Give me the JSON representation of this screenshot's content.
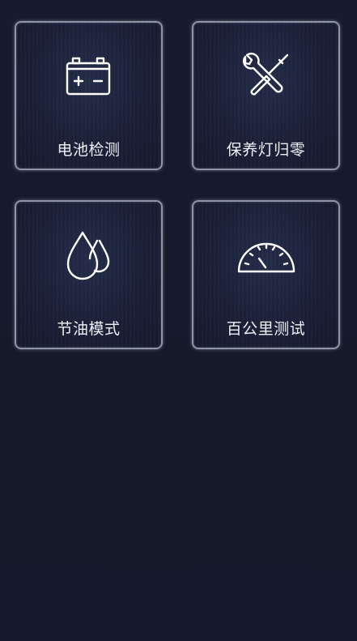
{
  "tiles": [
    {
      "label": "电池检测",
      "icon": "battery-icon"
    },
    {
      "label": "保养灯归零",
      "icon": "wrench-screwdriver-icon"
    },
    {
      "label": "节油模式",
      "icon": "water-drops-icon"
    },
    {
      "label": "百公里测试",
      "icon": "speedometer-icon"
    }
  ],
  "colors": {
    "background": "#161a2c",
    "tile_border": "#8e95a7",
    "text": "#eef1f6"
  }
}
